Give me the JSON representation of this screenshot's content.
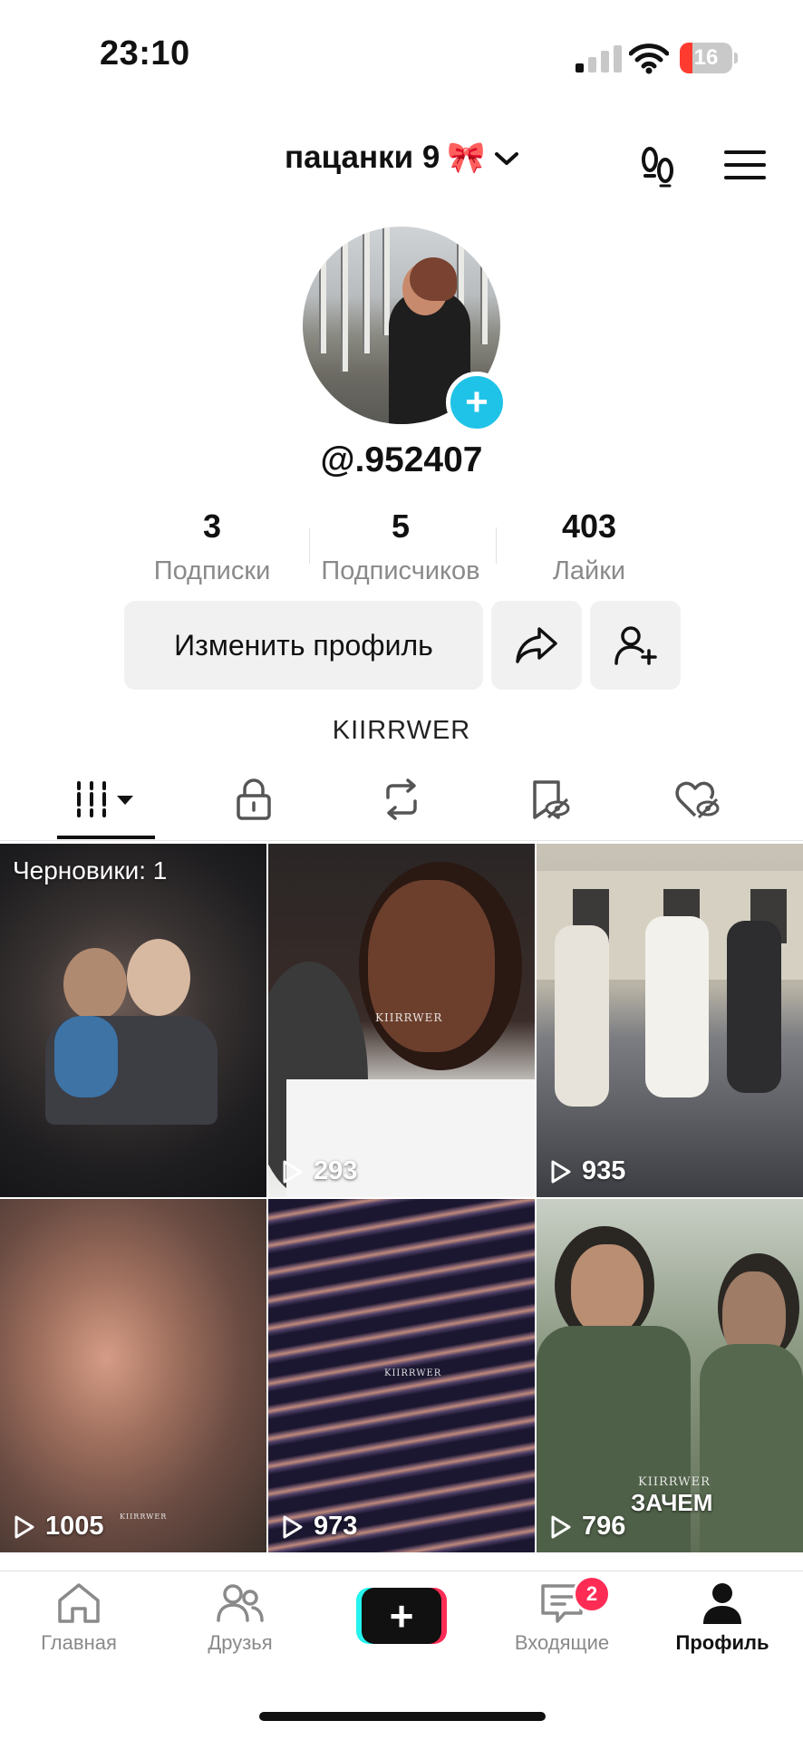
{
  "status_bar": {
    "time": "23:10",
    "battery": "16",
    "colors": {
      "battery_low": "#ff3b30"
    }
  },
  "header": {
    "account_name": "пацанки 9",
    "account_emoji": "🎀",
    "icons": [
      "chevron-down-icon",
      "footprints-icon",
      "menu-icon"
    ]
  },
  "profile": {
    "username": "@.952407",
    "bio": "KIIRRWER",
    "stats": [
      {
        "value": "3",
        "label": "Подписки"
      },
      {
        "value": "5",
        "label": "Подписчиков"
      },
      {
        "value": "403",
        "label": "Лайки"
      }
    ],
    "edit_button": "Изменить профиль"
  },
  "tabs": [
    "videos-grid-icon",
    "lock-icon",
    "repost-icon",
    "saved-icon",
    "liked-icon"
  ],
  "grid": {
    "draft_label": "Черновики: 1",
    "tiles": [
      {
        "views": ""
      },
      {
        "views": "293"
      },
      {
        "views": "935"
      },
      {
        "views": "1005"
      },
      {
        "views": "973"
      },
      {
        "views": "796"
      }
    ],
    "watermark": "KIIRRWER",
    "overlay_text": "ЗАЧЕМ"
  },
  "bottom_nav": {
    "items": [
      "Главная",
      "Друзья",
      "Входящие",
      "Профиль"
    ],
    "inbox_badge": "2",
    "accent_colors": {
      "cyan": "#25f4ee",
      "red": "#fe2c55"
    }
  }
}
